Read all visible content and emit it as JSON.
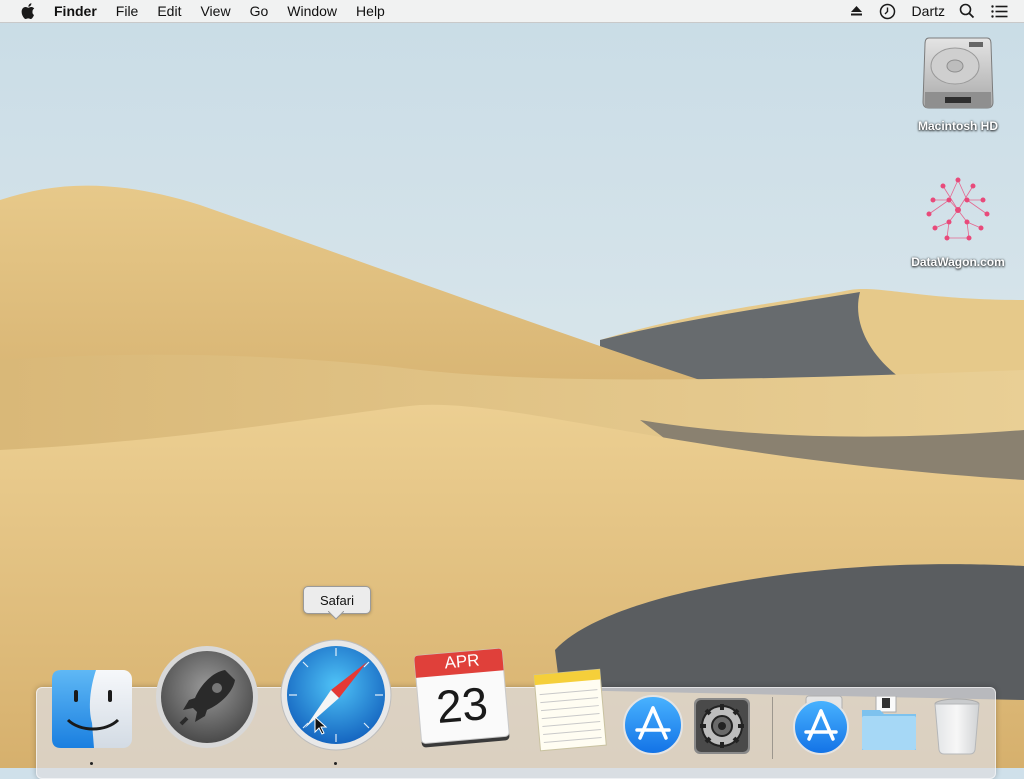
{
  "menubar": {
    "apple_icon": "apple-logo-icon",
    "app_name": "Finder",
    "menus": [
      "File",
      "Edit",
      "View",
      "Go",
      "Window",
      "Help"
    ],
    "status_icons": [
      "eject-icon",
      "time-machine-icon"
    ],
    "user_name": "Dartz",
    "right_icons": [
      "spotlight-search-icon",
      "notification-center-icon"
    ]
  },
  "desktop": {
    "icons": [
      {
        "label": "Macintosh HD",
        "icon": "hard-drive-icon"
      },
      {
        "label": "DataWagon.com",
        "icon": "network-share-icon"
      }
    ]
  },
  "dock": {
    "tooltip": "Safari",
    "calendar": {
      "month": "APR",
      "day": "23"
    },
    "items": [
      {
        "name": "Finder",
        "icon": "finder-icon",
        "running": true
      },
      {
        "name": "Launchpad",
        "icon": "launchpad-rocket-icon",
        "running": false
      },
      {
        "name": "Safari",
        "icon": "safari-compass-icon",
        "running": true
      },
      {
        "name": "Calendar",
        "icon": "calendar-icon",
        "running": false
      },
      {
        "name": "Notes",
        "icon": "notes-icon",
        "running": false
      },
      {
        "name": "App Store",
        "icon": "app-store-icon",
        "running": false
      },
      {
        "name": "System Preferences",
        "icon": "gear-icon",
        "running": false
      },
      {
        "name": "Applications",
        "icon": "applications-stack-icon",
        "running": false
      },
      {
        "name": "Downloads",
        "icon": "downloads-folder-icon",
        "running": false
      },
      {
        "name": "Trash",
        "icon": "trash-icon",
        "running": false
      }
    ]
  },
  "colors": {
    "sky": "#dbe8ee",
    "sand_light": "#e6c98a",
    "sand_mid": "#caa566",
    "shadow": "#5f6468",
    "safari_blue": "#1e88e5",
    "calendar_red": "#e0403a"
  }
}
